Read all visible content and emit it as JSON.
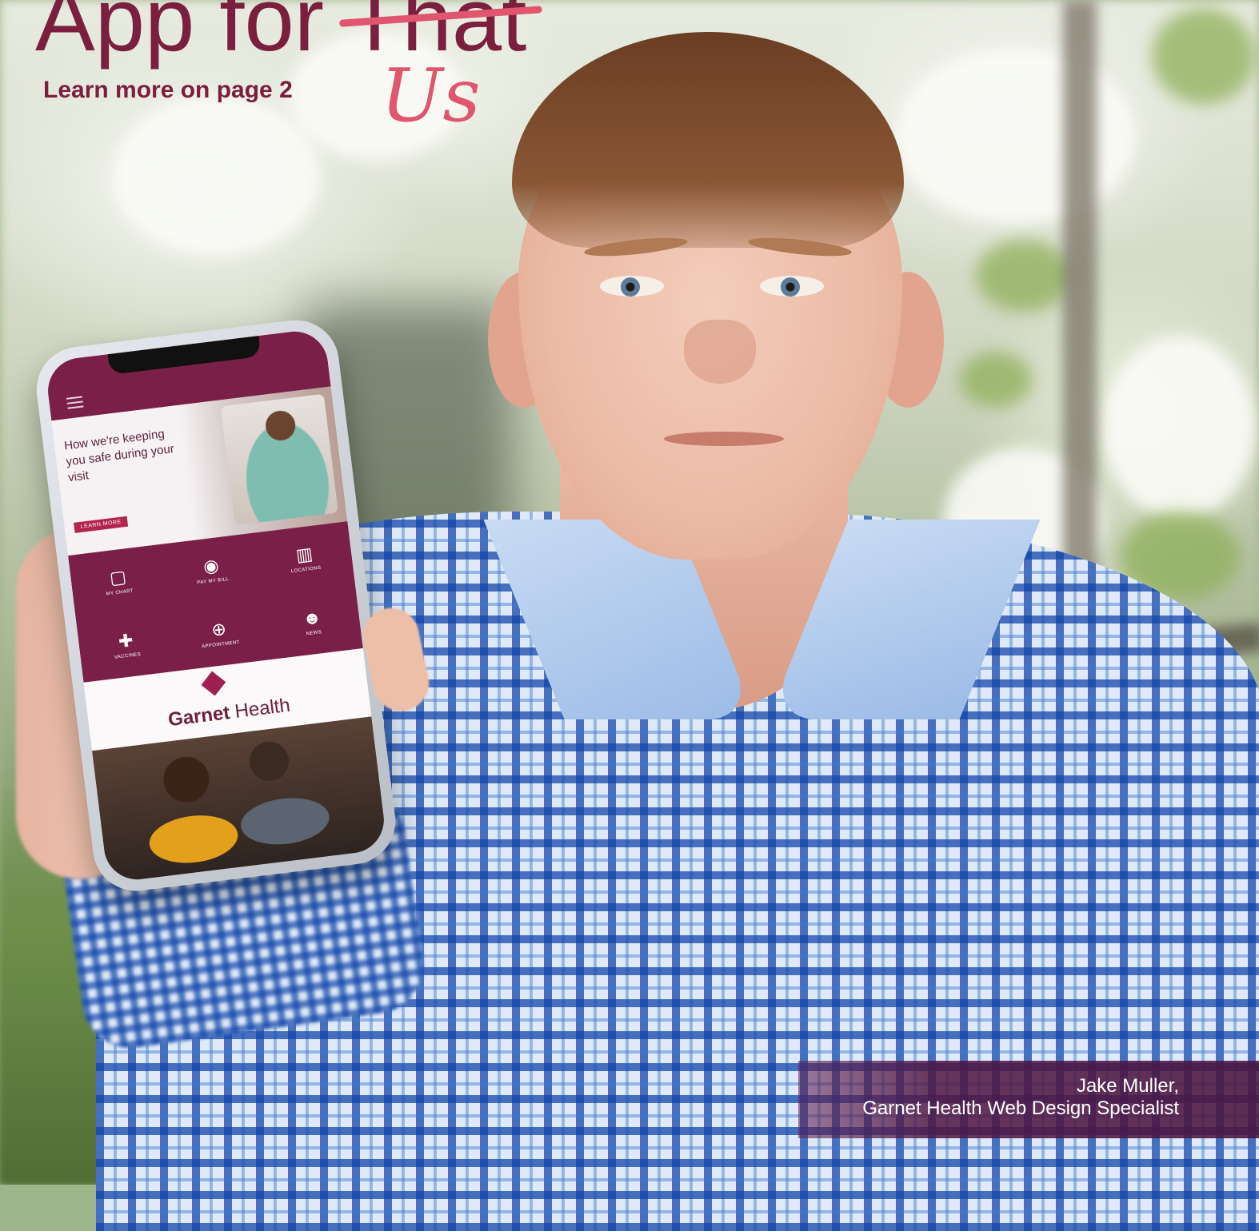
{
  "headline": {
    "prefix": "App for ",
    "struck_word": "That",
    "handwritten_word": "Us"
  },
  "subhead": "Learn more on page 2",
  "phone_screen": {
    "hero_text": "How we're keeping you safe during your visit",
    "hero_button": "LEARN MORE",
    "tiles": [
      {
        "icon": "my-chart-icon",
        "glyph": "▢",
        "label": "MY CHART"
      },
      {
        "icon": "pay-bill-icon",
        "glyph": "◉",
        "label": "PAY MY BILL"
      },
      {
        "icon": "locations-icon",
        "glyph": "▥",
        "label": "LOCATIONS"
      },
      {
        "icon": "vaccines-icon",
        "glyph": "✚",
        "label": "VACCINES"
      },
      {
        "icon": "appointment-icon",
        "glyph": "⊕",
        "label": "APPOINTMENT"
      },
      {
        "icon": "news-icon",
        "glyph": "☻",
        "label": "NEWS"
      }
    ],
    "brand_bold": "Garnet",
    "brand_rest": " Health"
  },
  "caption": {
    "line1": "Jake Muller,",
    "line2": "Garnet Health Web Design Specialist"
  },
  "colors": {
    "garnet": "#7a1f3d",
    "accent_pink": "#e0566f",
    "app_bar": "#7a2048"
  }
}
